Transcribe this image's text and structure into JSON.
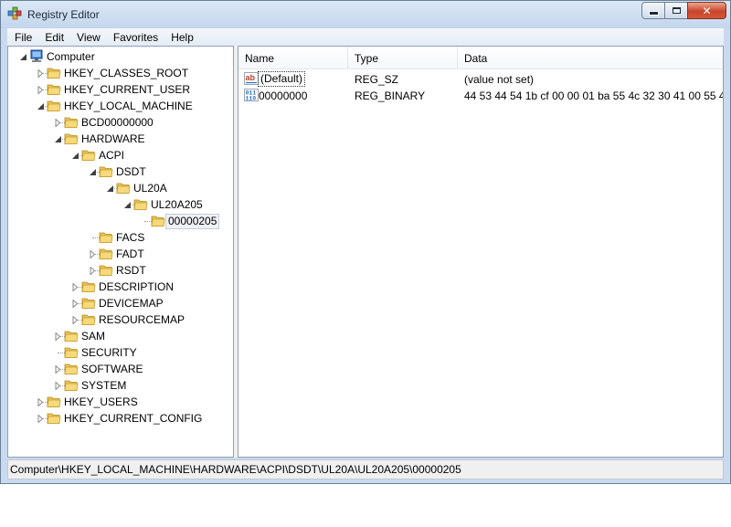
{
  "window": {
    "title": "Registry Editor",
    "close_glyph": "✕"
  },
  "menu": [
    "File",
    "Edit",
    "View",
    "Favorites",
    "Help"
  ],
  "tree": [
    {
      "label": "Computer",
      "expander": "open",
      "icon": "computer-icon"
    },
    {
      "label": "HKEY_CLASSES_ROOT",
      "expander": "closed",
      "icon": "folder-icon"
    },
    {
      "label": "HKEY_CURRENT_USER",
      "expander": "closed",
      "icon": "folder-icon"
    },
    {
      "label": "HKEY_LOCAL_MACHINE",
      "expander": "open",
      "icon": "folder-icon"
    },
    {
      "label": "BCD00000000",
      "expander": "closed",
      "icon": "folder-icon"
    },
    {
      "label": "HARDWARE",
      "expander": "open",
      "icon": "folder-icon"
    },
    {
      "label": "ACPI",
      "expander": "open",
      "icon": "folder-icon"
    },
    {
      "label": "DSDT",
      "expander": "open",
      "icon": "folder-icon"
    },
    {
      "label": "UL20A",
      "expander": "open",
      "icon": "folder-icon"
    },
    {
      "label": "UL20A205",
      "expander": "open",
      "icon": "folder-icon"
    },
    {
      "label": "00000205",
      "expander": "none",
      "icon": "folder-icon",
      "selected": true
    },
    {
      "label": "FACS",
      "expander": "none",
      "icon": "folder-icon"
    },
    {
      "label": "FADT",
      "expander": "closed",
      "icon": "folder-icon"
    },
    {
      "label": "RSDT",
      "expander": "closed",
      "icon": "folder-icon"
    },
    {
      "label": "DESCRIPTION",
      "expander": "closed",
      "icon": "folder-icon"
    },
    {
      "label": "DEVICEMAP",
      "expander": "closed",
      "icon": "folder-icon"
    },
    {
      "label": "RESOURCEMAP",
      "expander": "closed",
      "icon": "folder-icon"
    },
    {
      "label": "SAM",
      "expander": "closed",
      "icon": "folder-icon"
    },
    {
      "label": "SECURITY",
      "expander": "none",
      "icon": "folder-icon"
    },
    {
      "label": "SOFTWARE",
      "expander": "closed",
      "icon": "folder-icon"
    },
    {
      "label": "SYSTEM",
      "expander": "closed",
      "icon": "folder-icon"
    },
    {
      "label": "HKEY_USERS",
      "expander": "closed",
      "icon": "folder-icon"
    },
    {
      "label": "HKEY_CURRENT_CONFIG",
      "expander": "closed",
      "icon": "folder-icon"
    }
  ],
  "list": {
    "columns": [
      "Name",
      "Type",
      "Data"
    ],
    "rows": [
      {
        "name": "(Default)",
        "type": "REG_SZ",
        "data": "(value not set)",
        "icon": "string-value-icon"
      },
      {
        "name": "00000000",
        "type": "REG_BINARY",
        "data": "44 53 44 54 1b cf 00 00 01 ba 55 4c 32 30 41 00 55 4c...",
        "icon": "binary-value-icon"
      }
    ]
  },
  "status": {
    "path": "Computer\\HKEY_LOCAL_MACHINE\\HARDWARE\\ACPI\\DSDT\\UL20A\\UL20A205\\00000205"
  }
}
